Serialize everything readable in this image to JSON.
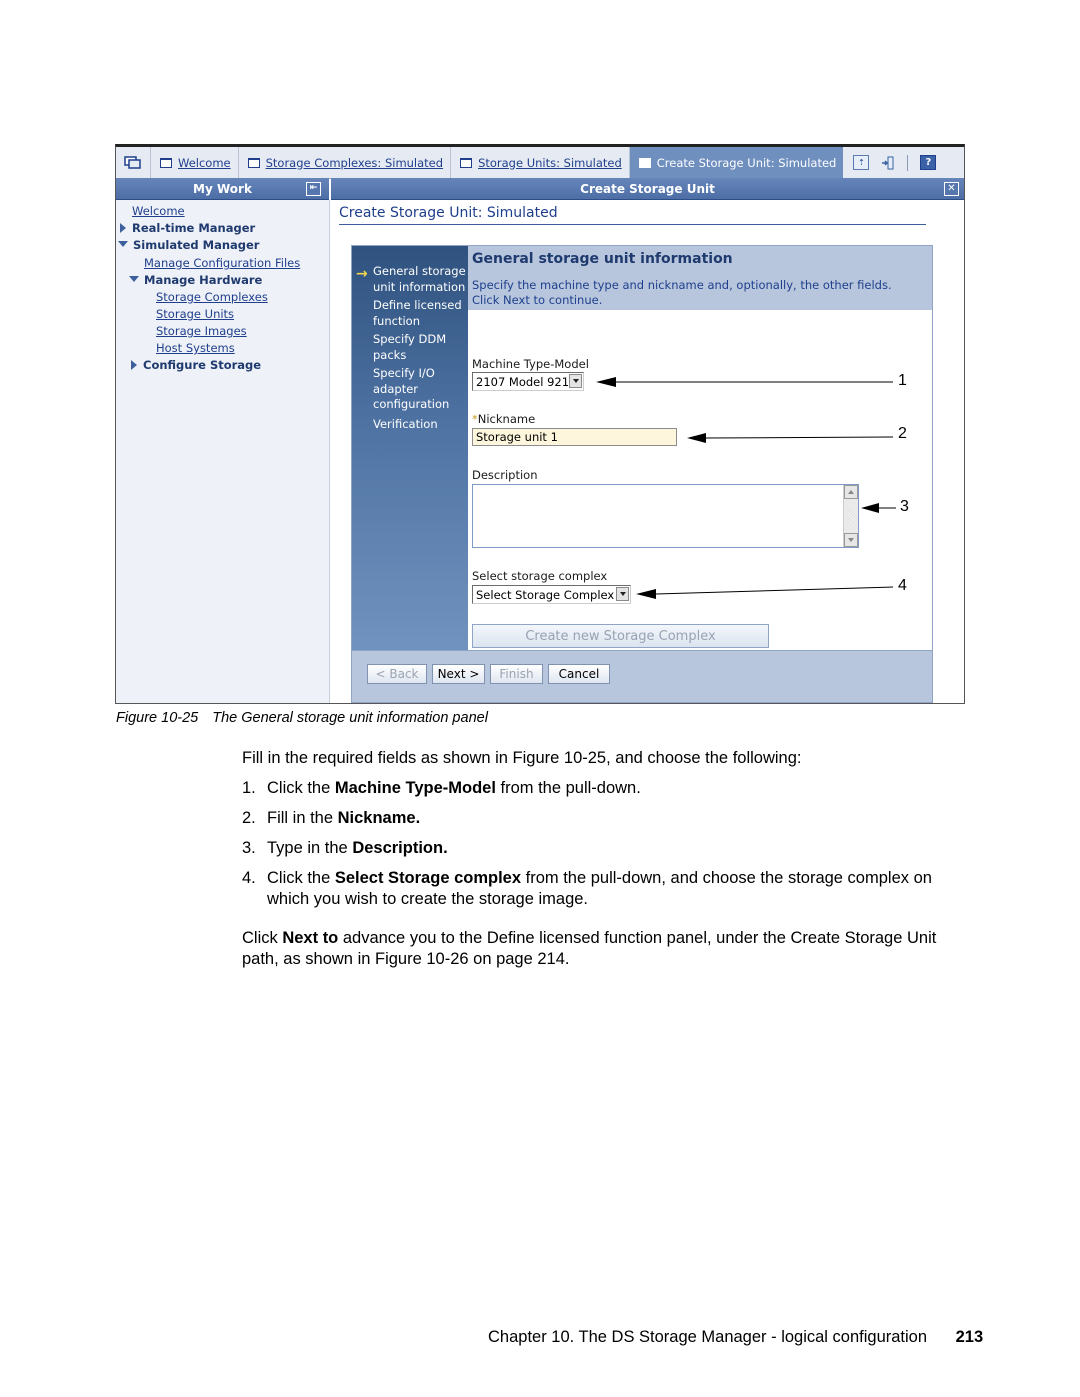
{
  "app": {
    "tabs": [
      {
        "label": "Welcome",
        "active": false
      },
      {
        "label": "Storage Complexes: Simulated",
        "active": false
      },
      {
        "label": "Storage Units: Simulated",
        "active": false
      },
      {
        "label": "Create Storage Unit: Simulated",
        "active": true
      }
    ],
    "toolbar_icons": [
      "print-icon",
      "exit-icon",
      "help-icon"
    ],
    "help_glyph": "?",
    "panels": {
      "my_work": "My Work",
      "create_storage_unit": "Create Storage Unit"
    },
    "nav": {
      "items": [
        {
          "label": "Welcome",
          "type": "link",
          "level": 0
        },
        {
          "label": "Real-time Manager",
          "type": "group",
          "expanded": false,
          "level": 0
        },
        {
          "label": "Simulated Manager",
          "type": "group",
          "expanded": true,
          "level": 0
        },
        {
          "label": "Manage Configuration Files",
          "type": "link",
          "level": 1
        },
        {
          "label": "Manage Hardware",
          "type": "group",
          "expanded": true,
          "level": 1
        },
        {
          "label": "Storage Complexes",
          "type": "link",
          "level": 2
        },
        {
          "label": "Storage Units",
          "type": "link",
          "level": 2
        },
        {
          "label": "Storage Images",
          "type": "link",
          "level": 2
        },
        {
          "label": "Host Systems",
          "type": "link",
          "level": 2
        },
        {
          "label": "Configure Storage",
          "type": "group",
          "expanded": false,
          "level": 1
        }
      ]
    },
    "main": {
      "title": "Create Storage Unit: Simulated",
      "wizard": {
        "steps": [
          {
            "label": "General storage unit information",
            "current": true
          },
          {
            "label": "Define licensed function",
            "current": false
          },
          {
            "label": "Specify DDM packs",
            "current": false
          },
          {
            "label": "Specify I/O adapter configuration",
            "current": false
          },
          {
            "label": "Verification",
            "current": false
          }
        ],
        "current_arrow": "→",
        "heading": "General storage unit information",
        "description": "Specify the machine type and nickname and, optionally, the other fields. Click Next to continue.",
        "fields": {
          "machine_type_model": {
            "label": "Machine Type-Model",
            "value": "2107 Model 921"
          },
          "nickname": {
            "label": "Nickname",
            "required_marker": "*",
            "value": "Storage unit 1"
          },
          "description": {
            "label": "Description",
            "value": ""
          },
          "storage_complex": {
            "label": "Select storage complex",
            "value": "Select Storage Complex"
          }
        },
        "create_complex_button": "Create new Storage Complex",
        "buttons": {
          "back": {
            "label": "< Back",
            "enabled": false
          },
          "next": {
            "label": "Next >",
            "enabled": true
          },
          "finish": {
            "label": "Finish",
            "enabled": false
          },
          "cancel": {
            "label": "Cancel",
            "enabled": true
          }
        }
      }
    },
    "callouts": [
      "1",
      "2",
      "3",
      "4"
    ]
  },
  "document": {
    "caption": {
      "figure": "Figure 10-25",
      "text": "The General storage unit information panel"
    },
    "intro": "Fill in the required fields as shown in Figure 10-25, and choose the following:",
    "steps": [
      {
        "num": "1.",
        "pre": "Click the ",
        "bold": "Machine Type-Model",
        "post": " from the pull-down."
      },
      {
        "num": "2.",
        "pre": "Fill in the ",
        "bold": "Nickname.",
        "post": ""
      },
      {
        "num": "3.",
        "pre": "Type in the ",
        "bold": "Description.",
        "post": ""
      },
      {
        "num": "4.",
        "pre": "Click the ",
        "bold": "Select Storage complex",
        "post": " from the pull-down, and choose the storage complex on which you wish to create the storage image."
      }
    ],
    "closing": {
      "pre": "Click ",
      "bold": "Next to",
      "post": " advance you to the Define licensed function panel, under the Create Storage Unit path, as shown in Figure 10-26 on page 214."
    },
    "footer": {
      "chapter": "Chapter 10. The DS Storage Manager - logical configuration",
      "page": "213"
    }
  }
}
